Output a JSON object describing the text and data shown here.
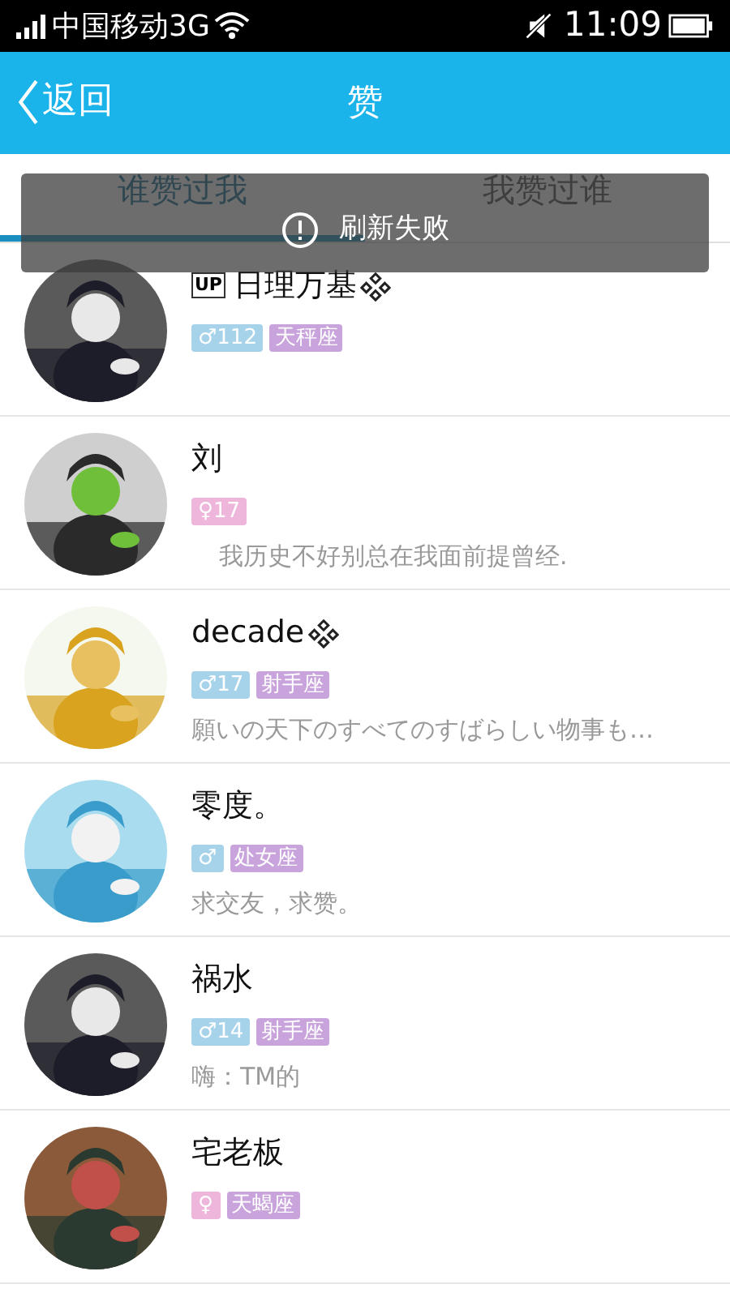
{
  "status_bar": {
    "carrier": "中国移动3G",
    "time": "11:09"
  },
  "header": {
    "back": "返回",
    "title": "赞"
  },
  "tabs": [
    {
      "label": "谁赞过我",
      "selected": true
    },
    {
      "label": "我赞过谁",
      "selected": false
    }
  ],
  "toast": {
    "text": "刷新失败"
  },
  "users": [
    {
      "name": "日理万基",
      "prefix": "UP",
      "sparkle": true,
      "gender": {
        "kind": "male",
        "symbol": "♂",
        "age": "112"
      },
      "sign": "天秤座"
    },
    {
      "name": "刘",
      "sparkle": false,
      "gender": {
        "kind": "female",
        "symbol": "♀",
        "age": "17"
      },
      "status": "我历史不好别总在我面前提曾经.",
      "indent": true
    },
    {
      "name": "decade",
      "sparkle": true,
      "gender": {
        "kind": "male",
        "symbol": "♂",
        "age": "17"
      },
      "sign": "射手座",
      "status": "願いの天下のすべてのすばらしい物事も…",
      "indent": false
    },
    {
      "name": "零度。",
      "sparkle": false,
      "gender": {
        "kind": "male",
        "symbol": "♂"
      },
      "sign": "处女座",
      "status": "求交友，求赞。",
      "indent": false
    },
    {
      "name": "祸水",
      "sparkle": false,
      "gender": {
        "kind": "male",
        "symbol": "♂",
        "age": "14"
      },
      "sign": "射手座",
      "status": "嗨：TM的",
      "indent": false
    },
    {
      "name": "宅老板",
      "sparkle": false,
      "gender": {
        "kind": "female",
        "symbol": "♀"
      },
      "sign": "天蝎座"
    }
  ]
}
